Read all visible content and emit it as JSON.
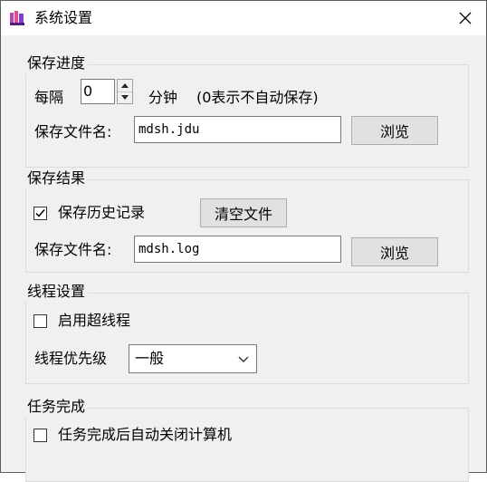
{
  "window": {
    "title": "系统设置"
  },
  "save_progress": {
    "legend": "保存进度",
    "interval_label": "每隔",
    "interval_value": "0",
    "unit_label": "分钟",
    "hint": "(0表示不自动保存)",
    "filename_label": "保存文件名:",
    "filename_value": "mdsh.jdu",
    "browse_label": "浏览"
  },
  "save_result": {
    "legend": "保存结果",
    "history_label": "保存历史记录",
    "history_checked": true,
    "clear_label": "清空文件",
    "filename_label": "保存文件名:",
    "filename_value": "mdsh.log",
    "browse_label": "浏览"
  },
  "thread_settings": {
    "legend": "线程设置",
    "hyperthread_label": "启用超线程",
    "hyperthread_checked": false,
    "priority_label": "线程优先级",
    "priority_value": "一般"
  },
  "task_complete": {
    "legend": "任务完成",
    "shutdown_label": "任务完成后自动关闭计算机",
    "shutdown_checked": false
  }
}
